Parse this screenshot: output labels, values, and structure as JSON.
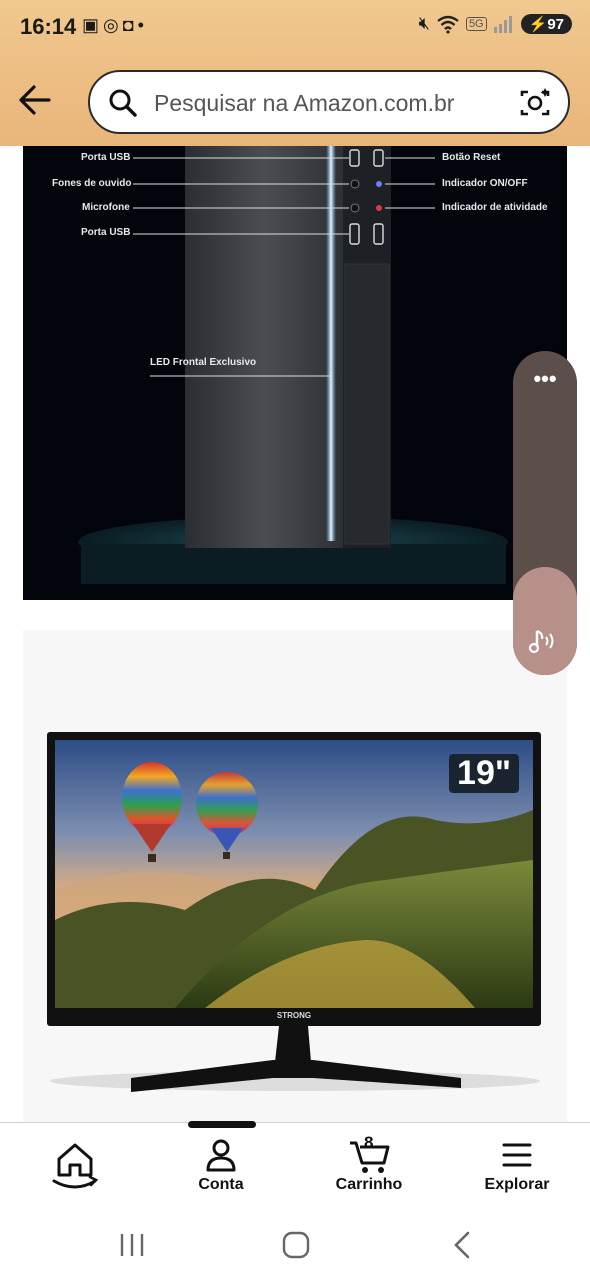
{
  "status_bar": {
    "time": "16:14",
    "battery": "97",
    "left_icons": [
      "screenshot-icon",
      "whatsapp-icon",
      "instagram-icon",
      "dot-icon"
    ],
    "right_icons": [
      "mute-icon",
      "wifi-icon",
      "5g-icon",
      "signal-icon"
    ]
  },
  "search": {
    "placeholder": "Pesquisar na Amazon.com.br"
  },
  "product_images": {
    "pc_labels_left": [
      "Porta USB",
      "Fones de ouvido",
      "Microfone",
      "Porta USB"
    ],
    "pc_labels_right": [
      "Botão Reset",
      "Indicador ON/OFF",
      "Indicador de atividade"
    ],
    "pc_led_label": "LED Frontal Exclusivo",
    "monitor_size_badge": "19\"",
    "monitor_brand": "STRONG"
  },
  "bottom_nav": {
    "items": [
      {
        "label": "",
        "icon": "home-icon"
      },
      {
        "label": "Conta",
        "icon": "person-icon"
      },
      {
        "label": "Carrinho",
        "icon": "cart-icon",
        "count": "8"
      },
      {
        "label": "Explorar",
        "icon": "menu-icon"
      }
    ]
  },
  "colors": {
    "header": "#e9b57a",
    "float_button": "#5c4f49",
    "music_button": "#b8908a"
  }
}
